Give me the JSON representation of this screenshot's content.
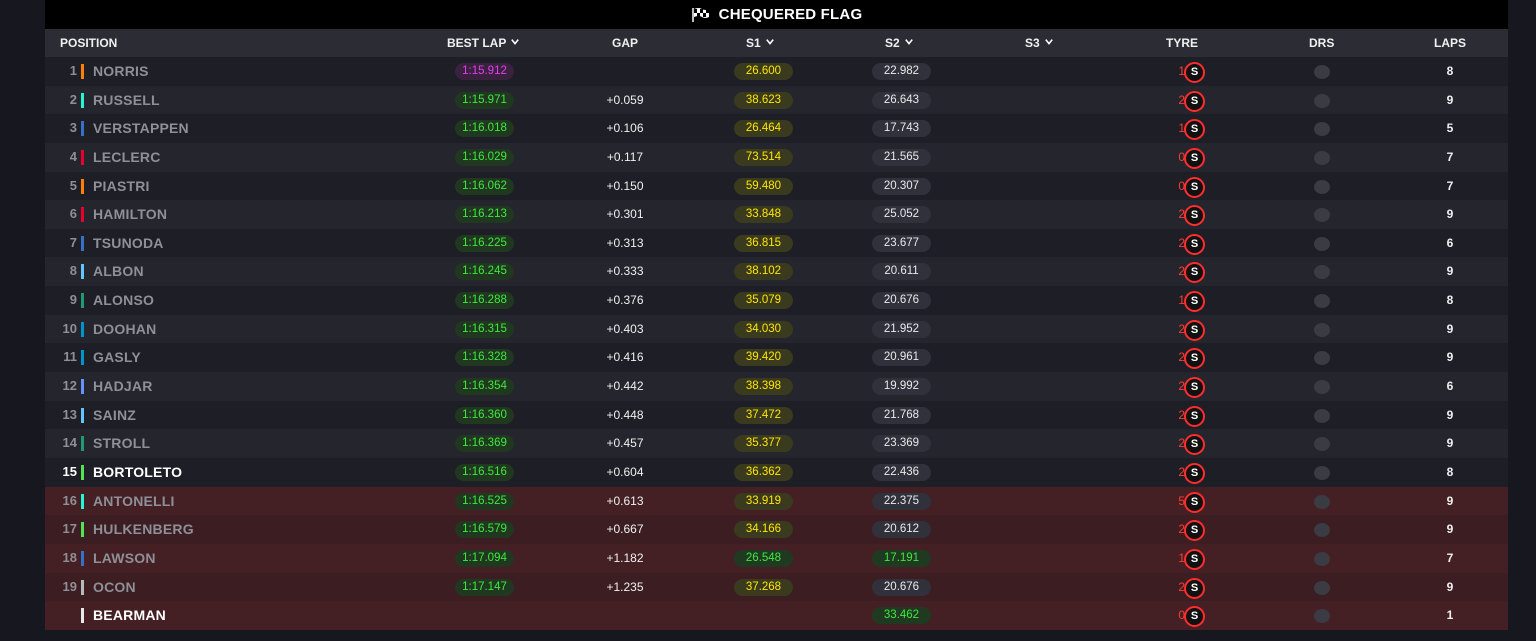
{
  "flag": {
    "text": "CHEQUERED FLAG",
    "icon": "chequered-flag-icon"
  },
  "columns": {
    "position": "POSITION",
    "best_lap": "BEST LAP",
    "gap": "GAP",
    "s1": "S1",
    "s2": "S2",
    "s3": "S3",
    "tyre": "TYRE",
    "drs": "DRS",
    "laps": "LAPS"
  },
  "colors": {
    "purple_fastest": "#e040e8",
    "green_personal": "#3ee83e",
    "yellow_sector": "#ffe600",
    "tyre_soft": "#ff2d2d",
    "eliminated_row": "#3c1d21"
  },
  "drivers": [
    {
      "pos": "1",
      "name": "NORRIS",
      "team_color": "#ff8000",
      "best_lap": "1:15.912",
      "best_style": "purple",
      "gap": "",
      "s1": "26.600",
      "s1_style": "yellow",
      "s2": "22.982",
      "s2_style": "white",
      "tyre_laps": "1",
      "tyre": "S",
      "laps": "8",
      "row": "odd"
    },
    {
      "pos": "2",
      "name": "RUSSELL",
      "team_color": "#27f4d2",
      "best_lap": "1:15.971",
      "best_style": "green",
      "gap": "+0.059",
      "s1": "38.623",
      "s1_style": "yellow",
      "s2": "26.643",
      "s2_style": "white",
      "tyre_laps": "2",
      "tyre": "S",
      "laps": "9",
      "row": "even"
    },
    {
      "pos": "3",
      "name": "VERSTAPPEN",
      "team_color": "#3671c6",
      "best_lap": "1:16.018",
      "best_style": "green",
      "gap": "+0.106",
      "s1": "26.464",
      "s1_style": "yellow",
      "s2": "17.743",
      "s2_style": "white",
      "tyre_laps": "1",
      "tyre": "S",
      "laps": "5",
      "row": "odd"
    },
    {
      "pos": "4",
      "name": "LECLERC",
      "team_color": "#e8002d",
      "best_lap": "1:16.029",
      "best_style": "green",
      "gap": "+0.117",
      "s1": "73.514",
      "s1_style": "yellow",
      "s2": "21.565",
      "s2_style": "white",
      "tyre_laps": "0",
      "tyre": "S",
      "laps": "7",
      "row": "even"
    },
    {
      "pos": "5",
      "name": "PIASTRI",
      "team_color": "#ff8000",
      "best_lap": "1:16.062",
      "best_style": "green",
      "gap": "+0.150",
      "s1": "59.480",
      "s1_style": "yellow",
      "s2": "20.307",
      "s2_style": "white",
      "tyre_laps": "0",
      "tyre": "S",
      "laps": "7",
      "row": "odd"
    },
    {
      "pos": "6",
      "name": "HAMILTON",
      "team_color": "#e8002d",
      "best_lap": "1:16.213",
      "best_style": "green",
      "gap": "+0.301",
      "s1": "33.848",
      "s1_style": "yellow",
      "s2": "25.052",
      "s2_style": "white",
      "tyre_laps": "2",
      "tyre": "S",
      "laps": "9",
      "row": "even"
    },
    {
      "pos": "7",
      "name": "TSUNODA",
      "team_color": "#3671c6",
      "best_lap": "1:16.225",
      "best_style": "green",
      "gap": "+0.313",
      "s1": "36.815",
      "s1_style": "yellow",
      "s2": "23.677",
      "s2_style": "white",
      "tyre_laps": "2",
      "tyre": "S",
      "laps": "6",
      "row": "odd"
    },
    {
      "pos": "8",
      "name": "ALBON",
      "team_color": "#64c4ff",
      "best_lap": "1:16.245",
      "best_style": "green",
      "gap": "+0.333",
      "s1": "38.102",
      "s1_style": "yellow",
      "s2": "20.611",
      "s2_style": "white",
      "tyre_laps": "2",
      "tyre": "S",
      "laps": "9",
      "row": "even"
    },
    {
      "pos": "9",
      "name": "ALONSO",
      "team_color": "#229971",
      "best_lap": "1:16.288",
      "best_style": "green",
      "gap": "+0.376",
      "s1": "35.079",
      "s1_style": "yellow",
      "s2": "20.676",
      "s2_style": "white",
      "tyre_laps": "1",
      "tyre": "S",
      "laps": "8",
      "row": "odd"
    },
    {
      "pos": "10",
      "name": "DOOHAN",
      "team_color": "#0093cc",
      "best_lap": "1:16.315",
      "best_style": "green",
      "gap": "+0.403",
      "s1": "34.030",
      "s1_style": "yellow",
      "s2": "21.952",
      "s2_style": "white",
      "tyre_laps": "2",
      "tyre": "S",
      "laps": "9",
      "row": "even"
    },
    {
      "pos": "11",
      "name": "GASLY",
      "team_color": "#0093cc",
      "best_lap": "1:16.328",
      "best_style": "green",
      "gap": "+0.416",
      "s1": "39.420",
      "s1_style": "yellow",
      "s2": "20.961",
      "s2_style": "white",
      "tyre_laps": "2",
      "tyre": "S",
      "laps": "9",
      "row": "odd"
    },
    {
      "pos": "12",
      "name": "HADJAR",
      "team_color": "#6692ff",
      "best_lap": "1:16.354",
      "best_style": "green",
      "gap": "+0.442",
      "s1": "38.398",
      "s1_style": "yellow",
      "s2": "19.992",
      "s2_style": "white",
      "tyre_laps": "2",
      "tyre": "S",
      "laps": "6",
      "row": "even"
    },
    {
      "pos": "13",
      "name": "SAINZ",
      "team_color": "#64c4ff",
      "best_lap": "1:16.360",
      "best_style": "green",
      "gap": "+0.448",
      "s1": "37.472",
      "s1_style": "yellow",
      "s2": "21.768",
      "s2_style": "white",
      "tyre_laps": "2",
      "tyre": "S",
      "laps": "9",
      "row": "odd"
    },
    {
      "pos": "14",
      "name": "STROLL",
      "team_color": "#229971",
      "best_lap": "1:16.369",
      "best_style": "green",
      "gap": "+0.457",
      "s1": "35.377",
      "s1_style": "yellow",
      "s2": "23.369",
      "s2_style": "white",
      "tyre_laps": "2",
      "tyre": "S",
      "laps": "9",
      "row": "even"
    },
    {
      "pos": "15",
      "name": "BORTOLETO",
      "team_color": "#52e252",
      "best_lap": "1:16.516",
      "best_style": "green",
      "gap": "+0.604",
      "s1": "36.362",
      "s1_style": "yellow",
      "s2": "22.436",
      "s2_style": "white",
      "tyre_laps": "2",
      "tyre": "S",
      "laps": "8",
      "row": "odd",
      "highlight": true
    },
    {
      "pos": "16",
      "name": "ANTONELLI",
      "team_color": "#27f4d2",
      "best_lap": "1:16.525",
      "best_style": "green",
      "gap": "+0.613",
      "s1": "33.919",
      "s1_style": "yellow",
      "s2": "22.375",
      "s2_style": "white",
      "tyre_laps": "5",
      "tyre": "S",
      "laps": "9",
      "row": "red-even"
    },
    {
      "pos": "17",
      "name": "HULKENBERG",
      "team_color": "#52e252",
      "best_lap": "1:16.579",
      "best_style": "green",
      "gap": "+0.667",
      "s1": "34.166",
      "s1_style": "yellow",
      "s2": "20.612",
      "s2_style": "white",
      "tyre_laps": "2",
      "tyre": "S",
      "laps": "9",
      "row": "red-odd"
    },
    {
      "pos": "18",
      "name": "LAWSON",
      "team_color": "#3671c6",
      "best_lap": "1:17.094",
      "best_style": "green",
      "gap": "+1.182",
      "s1": "26.548",
      "s1_style": "green",
      "s2": "17.191",
      "s2_style": "green",
      "tyre_laps": "1",
      "tyre": "S",
      "laps": "7",
      "row": "red-even"
    },
    {
      "pos": "19",
      "name": "OCON",
      "team_color": "#b6babd",
      "best_lap": "1:17.147",
      "best_style": "green",
      "gap": "+1.235",
      "s1": "37.268",
      "s1_style": "yellow",
      "s2": "20.676",
      "s2_style": "white",
      "tyre_laps": "2",
      "tyre": "S",
      "laps": "9",
      "row": "red-odd"
    },
    {
      "pos": "",
      "name": "BEARMAN",
      "team_color": "#e8e8e8",
      "best_lap": "",
      "best_style": "",
      "gap": "",
      "s1": "",
      "s1_style": "",
      "s2": "33.462",
      "s2_style": "green",
      "tyre_laps": "0",
      "tyre": "S",
      "laps": "1",
      "row": "red-even",
      "highlight": true
    }
  ]
}
